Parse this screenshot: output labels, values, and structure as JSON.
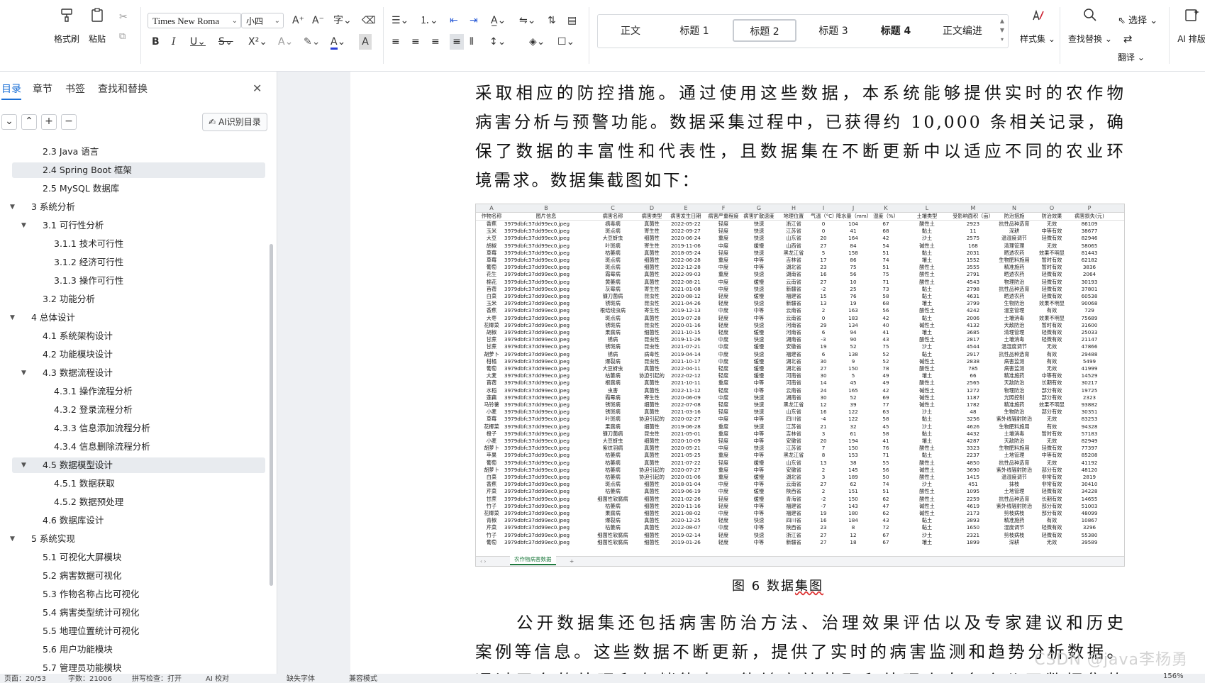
{
  "ribbon": {
    "format_painter": "格式刷",
    "paste": "粘贴",
    "font_name": "Times New Roma",
    "font_size": "小四",
    "styles": [
      "正文",
      "标题 1",
      "标题 2",
      "标题 3",
      "标题 4",
      "正文编进"
    ],
    "style_set": "样式集",
    "find_replace": "查找替换",
    "select": "选择",
    "translate": "翻译",
    "ai_layout": "AI 排版"
  },
  "nav_panel": {
    "tabs": [
      "目录",
      "章节",
      "书签",
      "查找和替换"
    ],
    "ai_toc_button": "AI识别目录",
    "toc": [
      {
        "label": "2.3 Java 语言"
      },
      {
        "label": "2.4 Spring Boot 框架"
      },
      {
        "label": "2.5 MySQL 数据库"
      },
      {
        "label": "3 系统分析"
      },
      {
        "label": "3.1 可行性分析"
      },
      {
        "label": "3.1.1 技术可行性"
      },
      {
        "label": "3.1.2 经济可行性"
      },
      {
        "label": "3.1.3 操作可行性"
      },
      {
        "label": "3.2 功能分析"
      },
      {
        "label": "4 总体设计"
      },
      {
        "label": "4.1 系统架构设计"
      },
      {
        "label": "4.2 功能模块设计"
      },
      {
        "label": "4.3 数据流程设计"
      },
      {
        "label": "4.3.1 操作流程分析"
      },
      {
        "label": "4.3.2 登录流程分析"
      },
      {
        "label": "4.3.3 信息添加流程分析"
      },
      {
        "label": "4.3.4 信息删除流程分析"
      },
      {
        "label": "4.5 数据模型设计"
      },
      {
        "label": "4.5.1 数据获取"
      },
      {
        "label": "4.5.2 数据预处理"
      },
      {
        "label": "4.6 数据库设计"
      },
      {
        "label": "5 系统实现"
      },
      {
        "label": "5.1 可视化大屏模块"
      },
      {
        "label": "5.2 病害数据可视化"
      },
      {
        "label": "5.3 作物名称占比可视化"
      },
      {
        "label": "5.4 病害类型统计可视化"
      },
      {
        "label": "5.5 地理位置统计可视化"
      },
      {
        "label": "5.6 用户功能模块"
      },
      {
        "label": "5.7 管理员功能模块"
      }
    ]
  },
  "document": {
    "para1_lines": [
      "采取相应的防控措施。通过使用这些数据，本系统能够提供实时的农作物",
      "病害分析与预警功能。数据采集过程中，已获得约 10,000 条相关记录，确",
      "保了数据的丰富性和代表性，且数据集在不断更新中以适应不同的农业环",
      "境需求。数据集截图如下："
    ],
    "figure_caption_prefix": "图 6  数据",
    "figure_caption_mark": "集图",
    "para2_lines": [
      "公开数据集还包括病害防治方法、治理效果评估以及专家建议和历史",
      "案例等信息。这些数据不断更新，提供了实时的病害监测和趋势分析数据。",
      "通过平台的处理和存储能力，能够高效获取和处理来自多个公开数据集的"
    ]
  },
  "spreadsheet": {
    "column_letters": [
      "A",
      "B",
      "C",
      "D",
      "E",
      "F",
      "G",
      "H",
      "I",
      "J",
      "K",
      "L",
      "M",
      "N",
      "O",
      "P"
    ],
    "headers": [
      "作物名称",
      "图片信息",
      "病害名称",
      "病害类型",
      "病害发生日期",
      "病害严重程度",
      "病害扩散速度",
      "地理位置",
      "气温（°C）",
      "降水量（mm）",
      "湿度（%）",
      "土壤类型",
      "受影响面积（亩）",
      "防治措施",
      "防治效果",
      "病害损失(元)"
    ],
    "image_value": "3979dbfc37dd99ec0.jpeg",
    "rows": [
      [
        "香蕉",
        "病毒病",
        "真菌性",
        "2022-05-22",
        "轻度",
        "快速",
        "浙江省",
        "0",
        "104",
        "67",
        "酸性土",
        "2923",
        "抗性品种选育",
        "无效",
        "86109"
      ],
      [
        "玉米",
        "斑点病",
        "寄生性",
        "2022-09-27",
        "轻度",
        "快速",
        "江苏省",
        "0",
        "41",
        "68",
        "黏土",
        "11",
        "深耕",
        "中等有效",
        "38677"
      ],
      [
        "大豆",
        "大豆蚜虫",
        "细菌性",
        "2020-06-24",
        "重度",
        "快速",
        "山东省",
        "20",
        "164",
        "42",
        "沙土",
        "2575",
        "温湿度调节",
        "轻微有效",
        "82946"
      ],
      [
        "胡椒",
        "叶斑病",
        "寄生性",
        "2019-11-06",
        "中度",
        "缓慢",
        "山西省",
        "27",
        "84",
        "54",
        "碱性土",
        "168",
        "清理管理",
        "无效",
        "58065"
      ],
      [
        "草莓",
        "枯萎病",
        "真菌性",
        "2018-05-24",
        "轻度",
        "快速",
        "黑龙江省",
        "5",
        "158",
        "51",
        "黏土",
        "2031",
        "晒透农药",
        "效果不明显",
        "81443"
      ],
      [
        "草莓",
        "斑点病",
        "细菌性",
        "2022-06-28",
        "重度",
        "中等",
        "吉林省",
        "17",
        "86",
        "74",
        "壤土",
        "1552",
        "生物肥料施用",
        "暂时有效",
        "62182"
      ],
      [
        "葡萄",
        "斑点病",
        "细菌性",
        "2022-12-28",
        "中度",
        "中等",
        "湖北省",
        "23",
        "75",
        "51",
        "酸性土",
        "3555",
        "精准施药",
        "暂时有效",
        "3836"
      ],
      [
        "花生",
        "霜霉病",
        "真菌性",
        "2022-09-03",
        "重度",
        "快速",
        "湖南省",
        "16",
        "56",
        "75",
        "酸性土",
        "2791",
        "晒透农药",
        "轻微有效",
        "2064"
      ],
      [
        "棉花",
        "黄萎病",
        "真菌性",
        "2022-08-21",
        "中度",
        "缓慢",
        "云南省",
        "27",
        "10",
        "71",
        "酸性土",
        "4543",
        "物理防治",
        "轻微有效",
        "30193"
      ],
      [
        "苜蓿",
        "灰霉病",
        "寄生性",
        "2021-01-08",
        "中度",
        "快速",
        "新疆省",
        "-2",
        "25",
        "73",
        "黏土",
        "2798",
        "抗性品种选育",
        "轻微有效",
        "37801"
      ],
      [
        "白菜",
        "镰刀菌病",
        "昆虫性",
        "2020-08-12",
        "轻度",
        "缓慢",
        "福建省",
        "15",
        "76",
        "58",
        "黏土",
        "4631",
        "晒透农药",
        "轻微有效",
        "60538"
      ],
      [
        "玉米",
        "锈斑病",
        "昆虫性",
        "2021-04-26",
        "轻度",
        "快速",
        "新疆省",
        "13",
        "19",
        "68",
        "壤土",
        "3799",
        "生物防治",
        "效果不明显",
        "90068"
      ],
      [
        "香蕉",
        "根结线虫病",
        "寄生性",
        "2019-12-13",
        "中度",
        "中等",
        "云南省",
        "2",
        "163",
        "56",
        "酸性土",
        "4242",
        "温室管理",
        "有效",
        "729"
      ],
      [
        "大枣",
        "斑点病",
        "真菌性",
        "2019-07-28",
        "轻度",
        "中等",
        "云南省",
        "0",
        "183",
        "42",
        "黏土",
        "2006",
        "土壤消毒",
        "效果不明显",
        "75689"
      ],
      [
        "花椰菜",
        "锈斑病",
        "昆虫性",
        "2020-01-16",
        "轻度",
        "快速",
        "河南省",
        "29",
        "134",
        "40",
        "碱性土",
        "4132",
        "天敌防治",
        "暂时有效",
        "31600"
      ],
      [
        "胡椒",
        "果腐病",
        "细菌性",
        "2021-10-15",
        "轻度",
        "缓慢",
        "河南省",
        "6",
        "94",
        "41",
        "壤土",
        "3685",
        "清理管理",
        "轻微有效",
        "25033"
      ],
      [
        "甘蔗",
        "锈病",
        "昆虫性",
        "2019-11-26",
        "中度",
        "快速",
        "湖南省",
        "-3",
        "90",
        "43",
        "酸性土",
        "2817",
        "土壤消毒",
        "轻微有效",
        "21147"
      ],
      [
        "甘蔗",
        "锈斑病",
        "昆虫性",
        "2021-07-21",
        "中度",
        "缓慢",
        "安徽省",
        "19",
        "52",
        "75",
        "沙土",
        "4544",
        "温湿度调节",
        "无效",
        "47866"
      ],
      [
        "胡萝卜",
        "锈病",
        "病毒性",
        "2019-04-14",
        "中度",
        "快速",
        "福建省",
        "6",
        "138",
        "52",
        "黏土",
        "2917",
        "抗性品种选育",
        "有效",
        "29488"
      ],
      [
        "柑橘",
        "爆裂病",
        "昆虫性",
        "2021-10-17",
        "中度",
        "缓慢",
        "湖北省",
        "30",
        "9",
        "52",
        "碱性土",
        "2838",
        "病害监测",
        "有效",
        "5499"
      ],
      [
        "葡萄",
        "大豆蚜虫",
        "真菌性",
        "2022-04-11",
        "轻度",
        "缓慢",
        "湖北省",
        "27",
        "150",
        "78",
        "酸性土",
        "785",
        "病害监测",
        "无效",
        "41999"
      ],
      [
        "大麦",
        "枯萎病",
        "协迫引起的",
        "2022-02-12",
        "轻度",
        "缓慢",
        "河南省",
        "30",
        "5",
        "49",
        "壤土",
        "66",
        "精准施药",
        "中等有效",
        "14529"
      ],
      [
        "苜蓿",
        "根腐病",
        "真菌性",
        "2021-10-11",
        "重度",
        "中等",
        "河南省",
        "14",
        "45",
        "49",
        "酸性土",
        "2565",
        "天敌防治",
        "长期有效",
        "30217"
      ],
      [
        "水稻",
        "虫害",
        "真菌性",
        "2022-11-12",
        "轻度",
        "中等",
        "云南省",
        "24",
        "165",
        "42",
        "碱性土",
        "1272",
        "物理防治",
        "部分有效",
        "19725"
      ],
      [
        "莲藕",
        "霜霉病",
        "寄生性",
        "2020-06-09",
        "中度",
        "快速",
        "湖南省",
        "30",
        "52",
        "69",
        "碱性土",
        "1187",
        "光照控制",
        "部分有效",
        "2323"
      ],
      [
        "马铃薯",
        "锈斑病",
        "细菌性",
        "2022-07-08",
        "轻度",
        "快速",
        "黑龙江省",
        "12",
        "39",
        "77",
        "碱性土",
        "1782",
        "精准施药",
        "效果不明显",
        "93882"
      ],
      [
        "小麦",
        "锈斑病",
        "真菌性",
        "2021-03-16",
        "轻度",
        "快速",
        "山东省",
        "16",
        "122",
        "63",
        "沙土",
        "48",
        "生物防治",
        "部分有效",
        "30351"
      ],
      [
        "草莓",
        "叶斑病",
        "协迫引起的",
        "2020-02-27",
        "中度",
        "中等",
        "四川省",
        "-4",
        "122",
        "58",
        "黏土",
        "3256",
        "紫外线辐射防治",
        "无效",
        "83253"
      ],
      [
        "花椰菜",
        "果腐病",
        "细菌性",
        "2019-06-28",
        "重度",
        "快速",
        "江苏省",
        "21",
        "32",
        "45",
        "沙土",
        "4626",
        "生物肥料施用",
        "有效",
        "94328"
      ],
      [
        "橙子",
        "镰刀菌病",
        "昆虫性",
        "2021-05-01",
        "重度",
        "中等",
        "吉林省",
        "3",
        "61",
        "58",
        "黏土",
        "4432",
        "土壤消毒",
        "暂时有效",
        "57183"
      ],
      [
        "小麦",
        "大豆蚜虫",
        "细菌性",
        "2020-10-09",
        "轻度",
        "中等",
        "安徽省",
        "20",
        "194",
        "41",
        "壤土",
        "4287",
        "天敌防治",
        "无效",
        "82949"
      ],
      [
        "胡萝卜",
        "紫纹羽病",
        "真菌性",
        "2020-05-21",
        "中度",
        "快速",
        "江苏省",
        "7",
        "150",
        "76",
        "酸性土",
        "3323",
        "生物肥料施用",
        "轻微有效",
        "77397"
      ],
      [
        "苹果",
        "枯萎病",
        "真菌性",
        "2021-05-25",
        "重度",
        "中等",
        "黑龙江省",
        "8",
        "153",
        "71",
        "黏土",
        "2237",
        "土地管理",
        "中等有效",
        "85208"
      ],
      [
        "葡萄",
        "枯萎病",
        "真菌性",
        "2021-07-22",
        "轻度",
        "缓慢",
        "山东省",
        "13",
        "38",
        "55",
        "酸性土",
        "4850",
        "抗性品种选育",
        "无效",
        "41192"
      ],
      [
        "胡萝卜",
        "枯萎病",
        "协迫引起的",
        "2020-07-27",
        "重度",
        "中等",
        "安徽省",
        "2",
        "145",
        "56",
        "碱性土",
        "3690",
        "紫外线辐射防治",
        "部分有效",
        "48120"
      ],
      [
        "白菜",
        "枯萎病",
        "协迫引起的",
        "2020-01-06",
        "重度",
        "缓慢",
        "湖北省",
        "3",
        "189",
        "50",
        "酸性土",
        "1415",
        "温湿度调节",
        "非常有效",
        "2819"
      ],
      [
        "香蕉",
        "斑点病",
        "细菌性",
        "2018-01-04",
        "中度",
        "中等",
        "云南省",
        "27",
        "62",
        "74",
        "沙土",
        "451",
        "抹枝",
        "非常有效",
        "30410"
      ],
      [
        "芹菜",
        "枯萎病",
        "真菌性",
        "2019-06-19",
        "中度",
        "缓慢",
        "陕西省",
        "2",
        "151",
        "51",
        "酸性土",
        "1095",
        "土地管理",
        "轻微有效",
        "34228"
      ],
      [
        "甘蔗",
        "细菌性软腐病",
        "细菌性",
        "2021-02-26",
        "轻度",
        "缓慢",
        "青海省",
        "-2",
        "150",
        "62",
        "酸性土",
        "2259",
        "抗性品种选育",
        "长期有效",
        "14655"
      ],
      [
        "竹子",
        "枯萎病",
        "细菌性",
        "2020-11-16",
        "轻度",
        "中等",
        "福建省",
        "-7",
        "143",
        "47",
        "碱性土",
        "4619",
        "紫外线辐射防治",
        "部分有效",
        "51003"
      ],
      [
        "花椰菜",
        "果腐病",
        "细菌性",
        "2021-08-02",
        "中度",
        "中等",
        "福建省",
        "19",
        "180",
        "62",
        "碱性土",
        "2173",
        "剪枝病枝",
        "部分有效",
        "48099"
      ],
      [
        "青椒",
        "爆裂病",
        "真菌性",
        "2020-12-25",
        "轻度",
        "快速",
        "四川省",
        "16",
        "184",
        "43",
        "黏土",
        "3893",
        "精准施药",
        "有效",
        "10867"
      ],
      [
        "芹菜",
        "枯萎病",
        "真菌性",
        "2022-08-07",
        "中度",
        "中等",
        "陕西省",
        "23",
        "8",
        "72",
        "黏土",
        "1650",
        "湿度调节",
        "轻微有效",
        "3296"
      ],
      [
        "竹子",
        "细菌性软腐病",
        "细菌性",
        "2019-02-14",
        "轻度",
        "快速",
        "浙江省",
        "27",
        "12",
        "67",
        "沙土",
        "2321",
        "剪枝病枝",
        "轻微有效",
        "55380"
      ],
      [
        "葡萄",
        "细菌性软腐病",
        "细菌性",
        "2019-01-26",
        "轻度",
        "中等",
        "新疆省",
        "27",
        "18",
        "67",
        "壤土",
        "1899",
        "深耕",
        "无效",
        "39589"
      ]
    ],
    "sheet_tab": "农作物病害数据"
  },
  "statusbar": {
    "page": "页面：20/53",
    "words": "字数：21006",
    "spell": "拼写检查：打开",
    "ai_proof": "AI 校对",
    "missing_font": "缺失字体",
    "compat": "兼容模式",
    "zoom": "156%"
  },
  "watermark": "CSDN @java李杨勇"
}
